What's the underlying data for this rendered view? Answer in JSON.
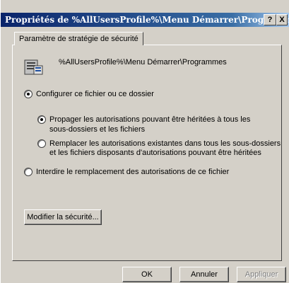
{
  "window": {
    "title": "Propriétés de %AllUsersProfile%\\Menu Démarrer\\Programmes",
    "help_label": "?",
    "close_label": "X"
  },
  "tab": {
    "label": "Paramètre de stratégie de sécurité"
  },
  "object": {
    "icon": "policy-icon",
    "path": "%AllUsersProfile%\\Menu Démarrer\\Programmes"
  },
  "options": {
    "configure": {
      "label": "Configurer ce fichier ou ce dossier",
      "checked": true
    },
    "propagate": {
      "line1": "Propager les autorisations pouvant être héritées à tous les",
      "line2": "sous-dossiers et les fichiers",
      "checked": true
    },
    "replace": {
      "line1": "Remplacer les autorisations existantes dans tous les sous-dossiers",
      "line2": "et les fichiers disposants d'autorisations pouvant être héritées",
      "checked": false
    },
    "prevent": {
      "label": "Interdire le remplacement des autorisations de ce fichier",
      "checked": false
    }
  },
  "buttons": {
    "modify": "Modifier la sécurité...",
    "ok": "OK",
    "cancel": "Annuler",
    "apply": "Appliquer"
  }
}
